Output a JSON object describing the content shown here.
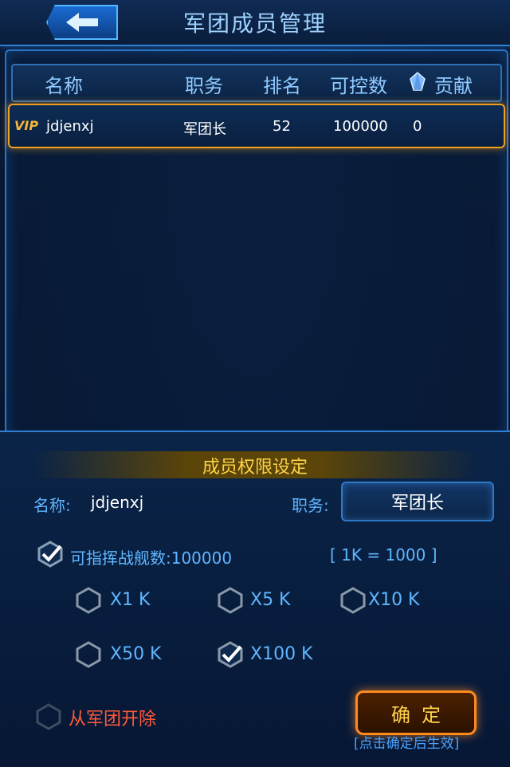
{
  "header": {
    "title": "军团成员管理",
    "back_icon": "back-arrow-icon"
  },
  "table": {
    "headers": [
      "名称",
      "职务",
      "排名",
      "可控数",
      "贡献"
    ],
    "rows": [
      {
        "vip": "VIP",
        "name": "jdjenxj",
        "duty": "军团长",
        "rank": "52",
        "control": "100000",
        "contribution": "0"
      }
    ]
  },
  "permissions": {
    "title": "成员权限设定",
    "name_label": "名称:",
    "name_value": "jdjenxj",
    "duty_label": "职务:",
    "duty_value": "军团长",
    "fleet_label": "可指挥战舰数:100000",
    "fleet_note": "[ 1K = 1000 ]",
    "options": [
      {
        "label": "X1 K",
        "checked": false
      },
      {
        "label": "X5 K",
        "checked": false
      },
      {
        "label": "X10 K",
        "checked": false
      },
      {
        "label": "X50 K",
        "checked": false
      },
      {
        "label": "X100 K",
        "checked": true
      }
    ],
    "expel_label": "从军团开除",
    "confirm_label": "确定",
    "hint": "[点击确定后生效]"
  },
  "colors": {
    "accent_blue": "#5fb6ff",
    "gold": "#ffd34a",
    "orange": "#ff8a1e",
    "danger": "#ff5a3a"
  }
}
